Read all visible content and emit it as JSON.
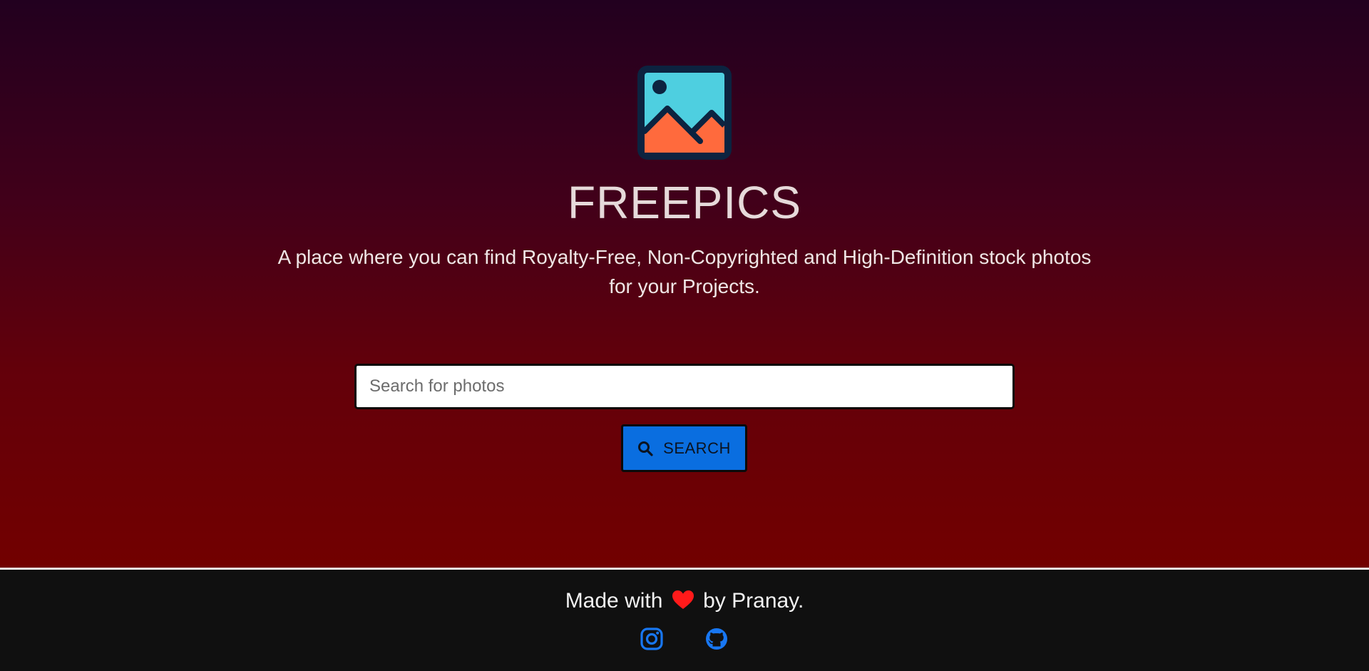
{
  "brand": {
    "title": "FREEPICS",
    "tagline": "A place where you can find Royalty-Free, Non-Copyrighted and High-Definition stock photos for your Projects.",
    "logo_icon": "image-landscape-icon"
  },
  "search": {
    "placeholder": "Search for photos",
    "value": "",
    "button_label": "SEARCH",
    "button_icon": "search-icon"
  },
  "footer": {
    "made_with_prefix": "Made with",
    "made_with_suffix": "by Pranay.",
    "heart_icon": "heart-icon",
    "social": [
      {
        "name": "instagram-icon"
      },
      {
        "name": "github-icon"
      }
    ]
  },
  "colors": {
    "hero_gradient_top": "#22001f",
    "hero_gradient_bottom": "#720000",
    "button_blue": "#0a6ee0",
    "footer_bg": "#101010",
    "heart": "#ff1a1a",
    "social_blue": "#1877f2",
    "logo_sky": "#4ecfe0",
    "logo_mountain": "#ff6a3d",
    "logo_frame": "#0c2340"
  }
}
